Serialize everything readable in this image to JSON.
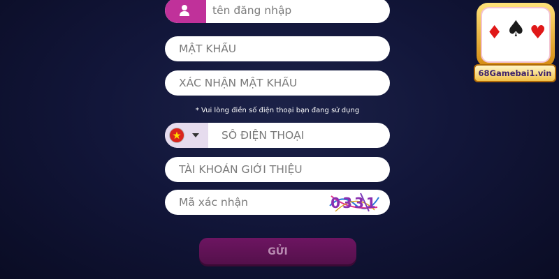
{
  "form": {
    "username_placeholder": "tên đăng nhập",
    "password_placeholder": "MẬT KHẨU",
    "confirm_password_placeholder": "XÁC NHẬN MẬT KHẨU",
    "phone_hint": "* Vui lòng điền số điện thoại bạn đang sử dụng",
    "phone_country": "vietnam-flag-icon",
    "phone_placeholder": "SỐ ĐIỆN THOẠI",
    "referral_placeholder": "TÀI KHOẢN GIỚI THIỆU",
    "captcha_placeholder": "Mã xác nhận",
    "captcha_code": "0331",
    "submit_label": "GỬI"
  },
  "logo": {
    "text": "68Gamebai1.vin"
  },
  "colors": {
    "background": "#12163a",
    "accent": "#c0319a",
    "button": "#6d1561",
    "button_text": "#b98cb2"
  }
}
